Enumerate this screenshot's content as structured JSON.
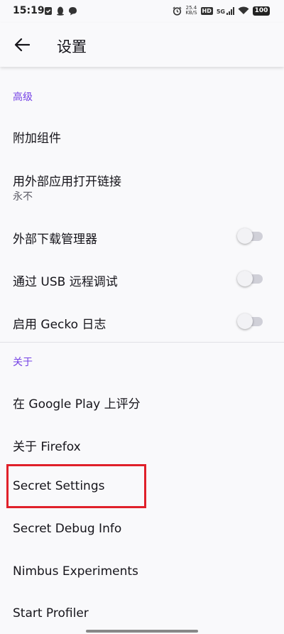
{
  "status_bar": {
    "time": "15:19",
    "net_speed_value": "25.4",
    "net_speed_unit": "KB/S",
    "hd_badge": "HD",
    "network": "5G",
    "battery": "100"
  },
  "toolbar": {
    "title": "设置"
  },
  "sections": {
    "advanced": {
      "header": "高级",
      "addons": "附加组件",
      "open_links_title": "用外部应用打开链接",
      "open_links_value": "永不",
      "external_download": "外部下载管理器",
      "remote_debug_usb": "通过 USB 远程调试",
      "gecko_logs": "启用 Gecko 日志"
    },
    "about": {
      "header": "关于",
      "rate_google_play": "在 Google Play 上评分",
      "about_firefox": "关于 Firefox",
      "secret_settings": "Secret Settings",
      "secret_debug_info": "Secret Debug Info",
      "nimbus_experiments": "Nimbus Experiments",
      "start_profiler": "Start Profiler"
    }
  },
  "toggles": {
    "external_download": false,
    "remote_debug_usb": false,
    "gecko_logs": false
  },
  "colors": {
    "accent": "#7542e5",
    "highlight": "#e0202a",
    "background": "#f9f9fb"
  }
}
